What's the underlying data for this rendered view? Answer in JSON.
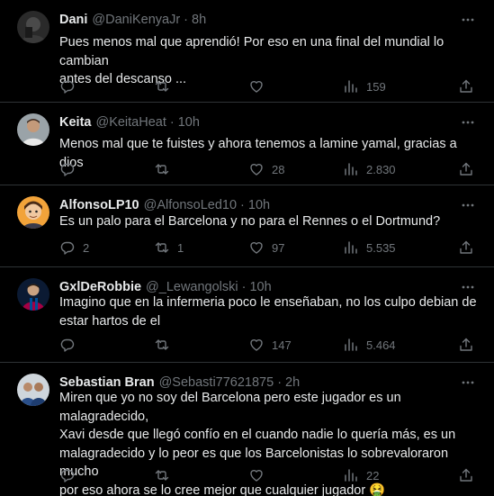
{
  "tweets": [
    {
      "name": "Dani",
      "handle": "@DaniKenyaJr",
      "time": "8h",
      "text": "Pues menos mal que aprendió! Por eso en una final del mundial lo cambian\nantes del descanso ...",
      "replies": "",
      "retweets": "",
      "likes": "",
      "views": "159",
      "avatar_icon": "avatar-dark-icon"
    },
    {
      "name": "Keita",
      "handle": "@KeitaHeat",
      "time": "10h",
      "text": "Menos mal que te fuistes y ahora tenemos a lamine yamal, gracias a dios",
      "replies": "",
      "retweets": "",
      "likes": "28",
      "views": "2.830",
      "avatar_icon": "avatar-person-icon"
    },
    {
      "name": "AlfonsoLP10",
      "handle": "@AlfonsoLed10",
      "time": "10h",
      "text": "Es un palo para el Barcelona y no para el Rennes o el Dortmund?",
      "replies": "2",
      "retweets": "1",
      "likes": "97",
      "views": "5.535",
      "avatar_icon": "avatar-cartoon-icon"
    },
    {
      "name": "GxlDeRobbie",
      "handle": "@_Lewangolski",
      "time": "10h",
      "text": "Imagino que en la infermeria poco le enseñaban, no los culpo debian de\nestar hartos de el",
      "replies": "",
      "retweets": "",
      "likes": "147",
      "views": "5.464",
      "avatar_icon": "avatar-player-icon"
    },
    {
      "name": "Sebastian Bran",
      "handle": "@Sebasti77621875",
      "time": "2h",
      "text": "Miren que yo no soy del Barcelona pero este jugador es un malagradecido,\nXavi desde que llegó confío en el cuando nadie lo quería más, es un\nmalagradecido y lo peor es que los Barcelonistas lo sobrevaloraron mucho\npor eso ahora se lo cree mejor que cualquier jugador 🤮",
      "replies": "",
      "retweets": "",
      "likes": "",
      "views": "22",
      "avatar_icon": "avatar-group-icon"
    }
  ],
  "colors": {
    "background": "#000000",
    "text": "#e7e9ea",
    "secondary": "#71767b",
    "divider": "#2f3336"
  }
}
